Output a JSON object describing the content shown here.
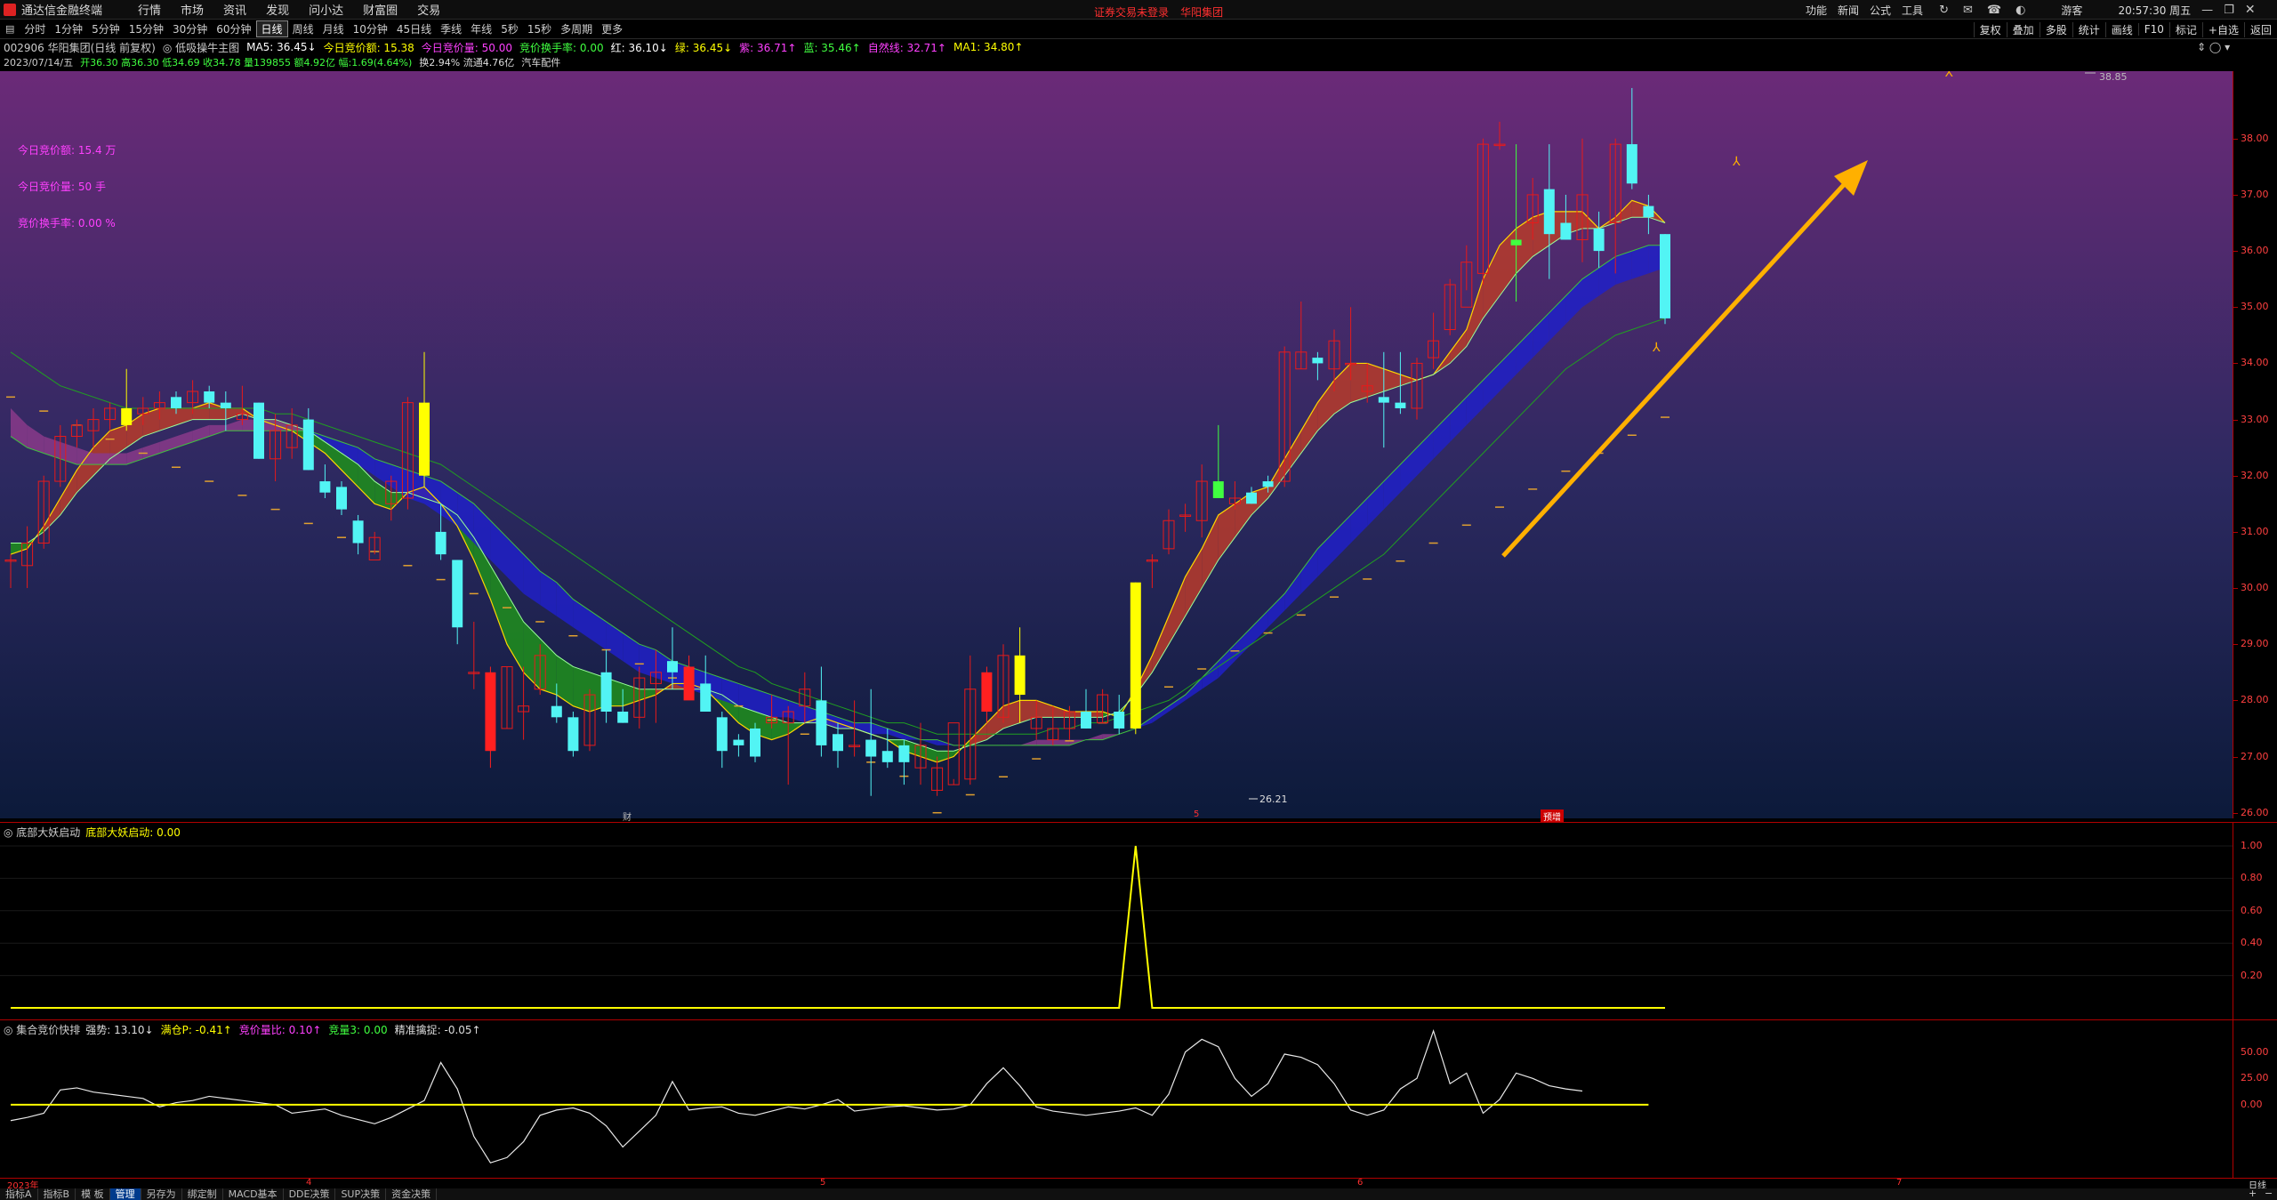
{
  "app": {
    "title": "通达信金融终端",
    "menu": [
      "行情",
      "市场",
      "资讯",
      "发现",
      "问小达",
      "财富圈",
      "交易"
    ],
    "center_notice": [
      "证券交易未登录",
      "华阳集团"
    ],
    "right_menu": [
      "功能",
      "新闻",
      "公式",
      "工具"
    ],
    "user": "游客",
    "clock": "20:57:30 周五"
  },
  "periods": [
    "分时",
    "1分钟",
    "5分钟",
    "15分钟",
    "30分钟",
    "60分钟",
    "日线",
    "周线",
    "月线",
    "10分钟",
    "45日线",
    "季线",
    "年线",
    "5秒",
    "15秒",
    "多周期",
    "更多"
  ],
  "active_period": "日线",
  "right_buttons": [
    "复权",
    "叠加",
    "多股",
    "统计",
    "画线",
    "F10",
    "标记",
    "+自选",
    "返回"
  ],
  "info": {
    "line1": [
      "002906 华阳集团(日线 前复权)",
      "◎ 低吸操牛主图",
      "MA5: 36.45↓",
      "今日竞价额: 15.38",
      "今日竞价量: 50.00",
      "竞价换手率: 0.00",
      "红: 36.10↓",
      "绿: 36.45↓",
      "紫: 36.71↑",
      "蓝: 35.46↑",
      "自然线: 32.71↑",
      "MA1: 34.80↑"
    ],
    "line2": [
      "2023/07/14/五",
      "开36.30 高36.30 低34.69 收34.78 量139855 额4.92亿 幅:1.69(4.64%)",
      "换2.94% 流通4.76亿",
      "汽车配件"
    ]
  },
  "colors": {
    "up": "#e81a1a",
    "down": "#52f4f4",
    "yellow": "#ffff00",
    "green": "#3bff3b",
    "magenta": "#ff2bff"
  },
  "overlay": [
    "今日竞价额: 15.4 万",
    "今日竞价量: 50 手",
    "竞价换手率: 0.00 %"
  ],
  "price_axis": [
    "38.00",
    "37.00",
    "36.00",
    "35.00",
    "34.00",
    "33.00",
    "32.00",
    "31.00",
    "30.00",
    "29.00",
    "28.00",
    "27.00",
    "26.00"
  ],
  "annotations": {
    "high": "38.85",
    "low": "26.21",
    "tags": [
      "财",
      "5",
      "预增"
    ]
  },
  "ind1": {
    "title": "◎ 底部大妖启动",
    "value_label": "底部大妖启动: 0.00",
    "axis": [
      "1.00",
      "0.80",
      "0.60",
      "0.40",
      "0.20"
    ]
  },
  "ind2": {
    "title": "◎ 集合竞价快排",
    "labels": [
      "强势: 13.10↓",
      "满仓P: -0.41↑",
      "竞价量比: 0.10↑",
      "竞量3: 0.00",
      "精准擒捉: -0.05↑"
    ],
    "axis": [
      "50.00",
      "25.00",
      "0.00"
    ]
  },
  "date_axis": [
    "2023年",
    "4",
    "5",
    "6",
    "7"
  ],
  "period_badge": "日线",
  "tabs": [
    "指标A",
    "指标B",
    "模 板",
    "管理",
    "另存为",
    "绑定制",
    "MACD基本",
    "DDE决策",
    "SUP决策",
    "资金决策"
  ],
  "active_tab": "管理",
  "chart_data": {
    "type": "candlestick",
    "ylim": [
      25.9,
      39.2
    ],
    "candles": [
      [
        30.5,
        30.6,
        30.0,
        30.5
      ],
      [
        30.4,
        31.1,
        30.0,
        30.8
      ],
      [
        30.8,
        32.0,
        30.7,
        31.9
      ],
      [
        31.9,
        32.9,
        31.8,
        32.7
      ],
      [
        32.7,
        33.0,
        32.5,
        32.9
      ],
      [
        32.8,
        33.2,
        32.5,
        33.0
      ],
      [
        33.0,
        33.3,
        32.8,
        33.2
      ],
      [
        33.2,
        33.9,
        32.8,
        32.9
      ],
      [
        33.1,
        33.4,
        32.9,
        33.2
      ],
      [
        33.2,
        33.5,
        33.0,
        33.3
      ],
      [
        33.4,
        33.5,
        33.1,
        33.2
      ],
      [
        33.3,
        33.7,
        33.1,
        33.5
      ],
      [
        33.5,
        33.6,
        33.2,
        33.3
      ],
      [
        33.3,
        33.5,
        32.8,
        33.2
      ],
      [
        33.0,
        33.6,
        32.9,
        33.1
      ],
      [
        33.3,
        33.3,
        32.3,
        32.3
      ],
      [
        32.3,
        33.1,
        31.9,
        32.8
      ],
      [
        32.5,
        33.2,
        32.3,
        32.9
      ],
      [
        33.0,
        33.2,
        32.1,
        32.1
      ],
      [
        31.9,
        32.2,
        31.6,
        31.7
      ],
      [
        31.8,
        31.9,
        31.3,
        31.4
      ],
      [
        31.2,
        31.3,
        30.6,
        30.8
      ],
      [
        30.5,
        31.0,
        30.6,
        30.9
      ],
      [
        31.5,
        32.0,
        31.2,
        31.9
      ],
      [
        31.6,
        33.4,
        31.4,
        33.3
      ],
      [
        33.3,
        34.2,
        31.8,
        32.0
      ],
      [
        31.0,
        31.5,
        30.5,
        30.6
      ],
      [
        30.5,
        30.5,
        29.0,
        29.3
      ],
      [
        28.5,
        29.4,
        28.2,
        28.5
      ],
      [
        28.5,
        28.6,
        26.8,
        27.1
      ],
      [
        27.5,
        28.6,
        27.5,
        28.6
      ],
      [
        27.8,
        28.6,
        27.3,
        27.9
      ],
      [
        28.2,
        29.0,
        28.1,
        28.8
      ],
      [
        27.9,
        28.3,
        27.6,
        27.7
      ],
      [
        27.7,
        27.8,
        27.0,
        27.1
      ],
      [
        27.2,
        28.2,
        27.1,
        28.1
      ],
      [
        28.5,
        28.9,
        27.6,
        27.8
      ],
      [
        27.8,
        28.2,
        27.6,
        27.6
      ],
      [
        27.7,
        28.6,
        27.5,
        28.4
      ],
      [
        28.3,
        28.9,
        27.6,
        28.5
      ],
      [
        28.7,
        29.3,
        28.2,
        28.5
      ],
      [
        28.6,
        28.8,
        28.1,
        28.0
      ],
      [
        28.3,
        28.8,
        27.8,
        27.8
      ],
      [
        27.7,
        27.8,
        26.8,
        27.1
      ],
      [
        27.3,
        27.4,
        27.0,
        27.2
      ],
      [
        27.5,
        27.6,
        26.9,
        27.0
      ],
      [
        27.6,
        28.1,
        27.5,
        27.7
      ],
      [
        27.6,
        27.9,
        26.5,
        27.8
      ],
      [
        27.9,
        28.5,
        27.6,
        28.2
      ],
      [
        28.0,
        28.6,
        27.0,
        27.2
      ],
      [
        27.4,
        27.6,
        26.8,
        27.1
      ],
      [
        27.2,
        28.0,
        27.0,
        27.2
      ],
      [
        27.3,
        28.2,
        26.3,
        27.0
      ],
      [
        27.1,
        27.5,
        26.8,
        26.9
      ],
      [
        27.2,
        27.3,
        26.5,
        26.9
      ],
      [
        26.8,
        27.6,
        26.5,
        27.2
      ],
      [
        26.4,
        27.0,
        26.3,
        26.8
      ],
      [
        26.5,
        26.6,
        26.5,
        27.6
      ],
      [
        26.6,
        28.8,
        26.5,
        28.2
      ],
      [
        28.5,
        28.6,
        27.6,
        27.8
      ],
      [
        27.7,
        29.0,
        27.6,
        28.8
      ],
      [
        28.8,
        29.3,
        27.6,
        28.1
      ],
      [
        27.5,
        28.0,
        27.3,
        27.7
      ],
      [
        27.3,
        27.9,
        27.2,
        27.5
      ],
      [
        27.5,
        27.9,
        27.3,
        27.8
      ],
      [
        27.8,
        28.2,
        27.5,
        27.5
      ],
      [
        27.6,
        28.2,
        27.6,
        28.1
      ],
      [
        27.8,
        28.1,
        27.4,
        27.5
      ],
      [
        27.5,
        30.1,
        27.4,
        30.1
      ],
      [
        30.5,
        30.6,
        30.0,
        30.5
      ],
      [
        30.7,
        31.4,
        30.6,
        31.2
      ],
      [
        31.3,
        31.5,
        31.0,
        31.3
      ],
      [
        31.2,
        32.2,
        30.9,
        31.9
      ],
      [
        31.6,
        32.9,
        31.6,
        31.9
      ],
      [
        31.5,
        31.9,
        31.4,
        31.6
      ],
      [
        31.7,
        31.8,
        31.5,
        31.5
      ],
      [
        31.9,
        32.0,
        31.7,
        31.8
      ],
      [
        31.9,
        34.3,
        31.8,
        34.2
      ],
      [
        33.9,
        35.1,
        33.9,
        34.2
      ],
      [
        34.1,
        34.2,
        33.7,
        34.0
      ],
      [
        33.9,
        34.6,
        33.5,
        34.4
      ],
      [
        34.0,
        35.0,
        33.7,
        34.0
      ],
      [
        33.5,
        34.0,
        33.3,
        33.6
      ],
      [
        33.4,
        34.2,
        32.5,
        33.3
      ],
      [
        33.3,
        34.2,
        33.1,
        33.2
      ],
      [
        33.2,
        34.1,
        33.0,
        34.0
      ],
      [
        34.1,
        34.9,
        33.9,
        34.4
      ],
      [
        34.6,
        35.5,
        34.5,
        35.4
      ],
      [
        35.0,
        36.1,
        35.3,
        35.8
      ],
      [
        35.6,
        38.0,
        35.4,
        37.9
      ],
      [
        37.9,
        38.3,
        37.8,
        37.9
      ],
      [
        36.1,
        37.9,
        35.1,
        36.2
      ],
      [
        36.5,
        37.3,
        36.2,
        37.0
      ],
      [
        37.1,
        37.9,
        35.5,
        36.3
      ],
      [
        36.5,
        37.0,
        36.2,
        36.2
      ],
      [
        36.2,
        38.0,
        35.8,
        37.0
      ],
      [
        36.4,
        36.7,
        35.7,
        36.0
      ],
      [
        36.5,
        38.0,
        35.6,
        37.9
      ],
      [
        37.9,
        38.9,
        37.1,
        37.2
      ],
      [
        36.8,
        37.0,
        36.3,
        36.6
      ],
      [
        36.3,
        36.3,
        34.7,
        34.8
      ]
    ],
    "ma_fast": [
      30.6,
      30.7,
      31.1,
      31.6,
      32.1,
      32.5,
      32.8,
      32.9,
      33.1,
      33.2,
      33.2,
      33.2,
      33.3,
      33.2,
      33.2,
      33.0,
      32.9,
      32.8,
      32.6,
      32.4,
      32.1,
      31.8,
      31.5,
      31.4,
      31.7,
      31.8,
      31.5,
      31.1,
      30.5,
      29.8,
      29.0,
      28.5,
      28.2,
      28.1,
      27.9,
      27.8,
      27.9,
      27.9,
      28.0,
      28.1,
      28.3,
      28.3,
      28.2,
      27.9,
      27.6,
      27.4,
      27.3,
      27.4,
      27.6,
      27.7,
      27.6,
      27.5,
      27.4,
      27.3,
      27.1,
      27.0,
      26.9,
      27.0,
      27.3,
      27.6,
      27.9,
      28.0,
      28.0,
      27.9,
      27.8,
      27.8,
      27.8,
      27.7,
      28.2,
      28.8,
      29.5,
      30.2,
      30.7,
      31.3,
      31.5,
      31.7,
      31.8,
      32.3,
      32.8,
      33.3,
      33.7,
      34.0,
      34.0,
      33.9,
      33.8,
      33.7,
      33.8,
      34.2,
      34.6,
      35.5,
      36.1,
      36.4,
      36.6,
      36.7,
      36.7,
      36.7,
      36.4,
      36.6,
      36.9,
      36.8,
      36.5
    ],
    "ma_mid": [
      30.8,
      30.8,
      31.0,
      31.3,
      31.7,
      32.0,
      32.3,
      32.5,
      32.7,
      32.8,
      32.9,
      33.0,
      33.0,
      33.0,
      33.1,
      33.0,
      33.0,
      32.9,
      32.8,
      32.6,
      32.4,
      32.2,
      31.9,
      31.7,
      31.7,
      31.6,
      31.5,
      31.3,
      30.9,
      30.4,
      29.9,
      29.4,
      29.1,
      28.8,
      28.6,
      28.5,
      28.4,
      28.3,
      28.2,
      28.2,
      28.2,
      28.2,
      28.2,
      28.1,
      27.9,
      27.8,
      27.7,
      27.6,
      27.6,
      27.6,
      27.5,
      27.5,
      27.4,
      27.3,
      27.3,
      27.2,
      27.1,
      27.1,
      27.2,
      27.3,
      27.5,
      27.6,
      27.7,
      27.7,
      27.7,
      27.7,
      27.7,
      27.8,
      28.1,
      28.5,
      29.0,
      29.5,
      30.0,
      30.5,
      30.9,
      31.3,
      31.6,
      32.0,
      32.4,
      32.8,
      33.1,
      33.3,
      33.4,
      33.5,
      33.6,
      33.7,
      33.8,
      34.0,
      34.3,
      34.8,
      35.2,
      35.6,
      35.9,
      36.1,
      36.3,
      36.4,
      36.4,
      36.5,
      36.6,
      36.6,
      36.5
    ],
    "ma_slow": [
      32.7,
      32.5,
      32.4,
      32.3,
      32.2,
      32.2,
      32.2,
      32.2,
      32.3,
      32.4,
      32.5,
      32.6,
      32.7,
      32.8,
      32.8,
      32.8,
      32.8,
      32.8,
      32.8,
      32.7,
      32.6,
      32.5,
      32.3,
      32.2,
      32.1,
      32.0,
      31.9,
      31.7,
      31.5,
      31.2,
      30.9,
      30.6,
      30.3,
      30.1,
      29.8,
      29.6,
      29.4,
      29.2,
      29.0,
      28.9,
      28.7,
      28.6,
      28.5,
      28.4,
      28.3,
      28.2,
      28.1,
      28.0,
      27.9,
      27.8,
      27.7,
      27.6,
      27.6,
      27.5,
      27.4,
      27.3,
      27.3,
      27.2,
      27.2,
      27.2,
      27.2,
      27.2,
      27.2,
      27.2,
      27.2,
      27.3,
      27.3,
      27.4,
      27.5,
      27.7,
      27.9,
      28.1,
      28.4,
      28.7,
      29.0,
      29.3,
      29.6,
      29.9,
      30.3,
      30.7,
      31.0,
      31.3,
      31.6,
      31.9,
      32.2,
      32.5,
      32.8,
      33.1,
      33.4,
      33.7,
      34.0,
      34.3,
      34.6,
      34.9,
      35.2,
      35.5,
      35.7,
      35.9,
      36.0,
      36.1,
      36.1
    ],
    "ma_blue": [
      33.2,
      32.9,
      32.7,
      32.6,
      32.5,
      32.4,
      32.4,
      32.4,
      32.5,
      32.6,
      32.7,
      32.8,
      32.9,
      32.9,
      33.0,
      33.0,
      33.0,
      32.9,
      32.8,
      32.6,
      32.4,
      32.2,
      32.0,
      31.8,
      31.6,
      31.5,
      31.3,
      31.1,
      30.8,
      30.5,
      30.2,
      29.9,
      29.7,
      29.5,
      29.3,
      29.1,
      28.9,
      28.7,
      28.5,
      28.4,
      28.3,
      28.2,
      28.1,
      28.0,
      27.9,
      27.8,
      27.7,
      27.7,
      27.6,
      27.6,
      27.5,
      27.5,
      27.4,
      27.4,
      27.3,
      27.3,
      27.2,
      27.2,
      27.2,
      27.2,
      27.2,
      27.2,
      27.3,
      27.3,
      27.3,
      27.3,
      27.4,
      27.4,
      27.5,
      27.6,
      27.8,
      28.0,
      28.2,
      28.4,
      28.7,
      29.0,
      29.3,
      29.6,
      29.9,
      30.2,
      30.5,
      30.8,
      31.1,
      31.4,
      31.7,
      32.0,
      32.3,
      32.6,
      32.9,
      33.2,
      33.5,
      33.8,
      34.1,
      34.4,
      34.7,
      35.0,
      35.2,
      35.4,
      35.5,
      35.6,
      35.7
    ],
    "ma_long": [
      34.2,
      34.0,
      33.8,
      33.6,
      33.5,
      33.4,
      33.3,
      33.2,
      33.2,
      33.2,
      33.2,
      33.2,
      33.2,
      33.2,
      33.2,
      33.2,
      33.1,
      33.1,
      33.0,
      32.9,
      32.8,
      32.7,
      32.6,
      32.5,
      32.4,
      32.3,
      32.2,
      32.0,
      31.8,
      31.6,
      31.4,
      31.2,
      31.0,
      30.8,
      30.6,
      30.4,
      30.2,
      30.0,
      29.8,
      29.6,
      29.4,
      29.2,
      29.0,
      28.8,
      28.6,
      28.5,
      28.3,
      28.2,
      28.1,
      28.0,
      27.9,
      27.8,
      27.7,
      27.6,
      27.6,
      27.5,
      27.4,
      27.4,
      27.4,
      27.4,
      27.4,
      27.4,
      27.4,
      27.5,
      27.5,
      27.6,
      27.6,
      27.7,
      27.8,
      27.9,
      28.0,
      28.2,
      28.4,
      28.6,
      28.8,
      29.0,
      29.2,
      29.4,
      29.6,
      29.8,
      30.0,
      30.2,
      30.4,
      30.6,
      30.9,
      31.2,
      31.5,
      31.8,
      32.1,
      32.4,
      32.7,
      33.0,
      33.3,
      33.6,
      33.9,
      34.1,
      34.3,
      34.5,
      34.6,
      34.7,
      34.8
    ],
    "ind1_values": [
      0,
      0,
      0,
      0,
      0,
      0,
      0,
      0,
      0,
      0,
      0,
      0,
      0,
      0,
      0,
      0,
      0,
      0,
      0,
      0,
      0,
      0,
      0,
      0,
      0,
      0,
      0,
      0,
      0,
      0,
      0,
      0,
      0,
      0,
      0,
      0,
      0,
      0,
      0,
      0,
      0,
      0,
      0,
      0,
      0,
      0,
      0,
      0,
      0,
      0,
      0,
      0,
      0,
      0,
      0,
      0,
      0,
      0,
      0,
      0,
      0,
      0,
      0,
      0,
      0,
      0,
      0,
      0,
      1,
      0,
      0,
      0,
      0,
      0,
      0,
      0,
      0,
      0,
      0,
      0,
      0,
      0,
      0,
      0,
      0,
      0,
      0,
      0,
      0,
      0,
      0,
      0,
      0,
      0,
      0,
      0,
      0,
      0,
      0,
      0,
      0
    ],
    "ind2_white": [
      -15,
      -12,
      -8,
      14,
      16,
      12,
      10,
      8,
      6,
      -2,
      2,
      4,
      8,
      6,
      4,
      2,
      0,
      -8,
      -6,
      -4,
      -10,
      -14,
      -18,
      -12,
      -4,
      4,
      40,
      15,
      -30,
      -55,
      -50,
      -35,
      -10,
      -5,
      -3,
      -8,
      -20,
      -40,
      -25,
      -10,
      22,
      -5,
      -3,
      -2,
      -8,
      -10,
      -6,
      -2,
      -4,
      0,
      5,
      -6,
      -4,
      -2,
      -1,
      -3,
      -5,
      -4,
      0,
      20,
      35,
      18,
      -2,
      -6,
      -8,
      -10,
      -8,
      -6,
      -3,
      -10,
      10,
      50,
      62,
      55,
      25,
      8,
      20,
      48,
      45,
      38,
      20,
      -5,
      -10,
      -5,
      15,
      25,
      70,
      20,
      30,
      -8,
      5,
      30,
      25,
      18,
      15,
      13
    ],
    "ind2_yellow": [
      0,
      0,
      0,
      0,
      0,
      0,
      0,
      0,
      0,
      0,
      0,
      0,
      0,
      0,
      0,
      0,
      0,
      0,
      0,
      0,
      0,
      0,
      0,
      0,
      0,
      0,
      0,
      0,
      0,
      0,
      0,
      0,
      0,
      0,
      0,
      0,
      0,
      0,
      0,
      0,
      0,
      0,
      0,
      0,
      0,
      0,
      0,
      0,
      0,
      0,
      0,
      0,
      0,
      0,
      0,
      0,
      0,
      0,
      0,
      0,
      0,
      0,
      0,
      0,
      0,
      0,
      0,
      0,
      0,
      0,
      0,
      0,
      0,
      0,
      0,
      0,
      0,
      0,
      0,
      0,
      0,
      0,
      0,
      0,
      0,
      0,
      0,
      0,
      0,
      0,
      0,
      0,
      0,
      0,
      0,
      0,
      0,
      0,
      0,
      0
    ],
    "ind2_ylim": [
      -70,
      80
    ]
  }
}
